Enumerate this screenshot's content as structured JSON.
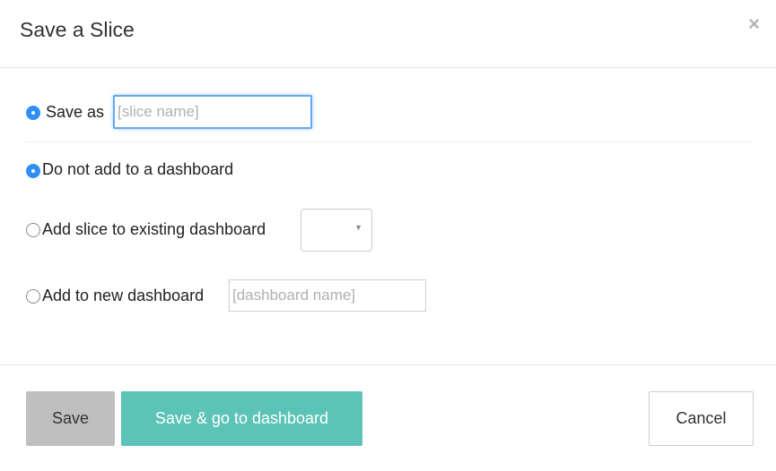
{
  "modal": {
    "title": "Save a Slice",
    "close_glyph": "×"
  },
  "save_as": {
    "label": "Save as",
    "selected": true,
    "input_placeholder": "[slice name]",
    "input_value": ""
  },
  "dashboard_options": {
    "no_dashboard": {
      "label": "Do not add to a dashboard",
      "selected": true
    },
    "existing_dashboard": {
      "label": "Add slice to existing dashboard",
      "selected": false,
      "select_value": "",
      "caret_glyph": "▼"
    },
    "new_dashboard": {
      "label": "Add to new dashboard",
      "selected": false,
      "input_placeholder": "[dashboard name]",
      "input_value": ""
    }
  },
  "footer": {
    "save_label": "Save",
    "save_goto_label": "Save & go to dashboard",
    "cancel_label": "Cancel"
  },
  "colors": {
    "radio_selected": "#2f8ff5",
    "save_goto_button": "#5cc3b7",
    "save_button": "#bfbfbf",
    "focus_ring": "#66a9f0"
  },
  "icons": {
    "close": "close-icon",
    "select_caret": "chevron-down-icon"
  }
}
